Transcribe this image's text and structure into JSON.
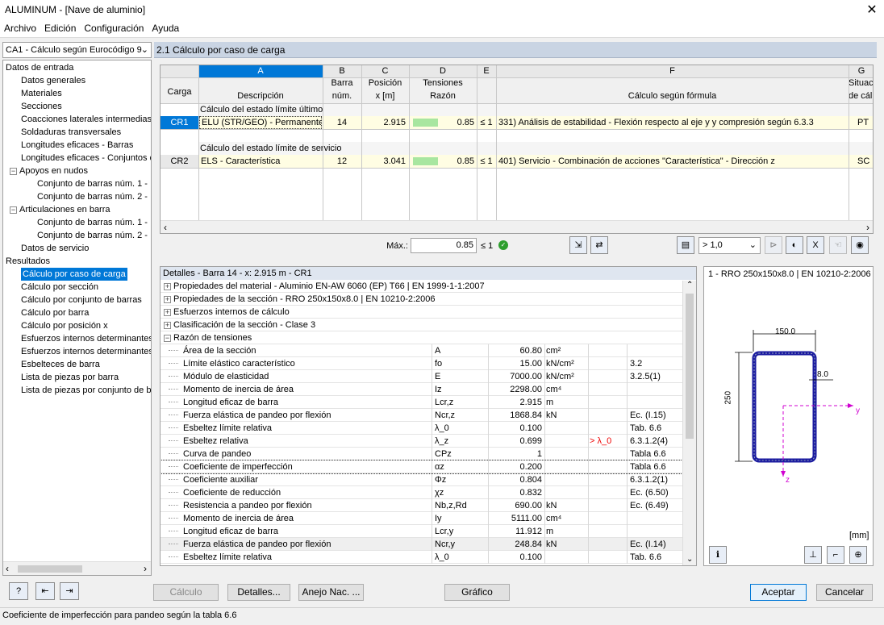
{
  "window": {
    "title": "ALUMINUM - [Nave de aluminio]"
  },
  "menu": [
    "Archivo",
    "Edición",
    "Configuración",
    "Ayuda"
  ],
  "case_selector": "CA1 - Cálculo según Eurocódigo 9",
  "tree": [
    {
      "label": "Datos de entrada",
      "level": 0
    },
    {
      "label": "Datos generales",
      "level": 1
    },
    {
      "label": "Materiales",
      "level": 1
    },
    {
      "label": "Secciones",
      "level": 1
    },
    {
      "label": "Coacciones laterales intermedias",
      "level": 1
    },
    {
      "label": "Soldaduras transversales",
      "level": 1
    },
    {
      "label": "Longitudes eficaces - Barras",
      "level": 1
    },
    {
      "label": "Longitudes eficaces - Conjuntos d",
      "level": 1
    },
    {
      "label": "Apoyos en nudos",
      "level": 1,
      "toggle": "−"
    },
    {
      "label": "Conjunto de barras núm. 1 -",
      "level": 2
    },
    {
      "label": "Conjunto de barras núm. 2 -",
      "level": 2
    },
    {
      "label": "Articulaciones en barra",
      "level": 1,
      "toggle": "−"
    },
    {
      "label": "Conjunto de barras núm. 1 -",
      "level": 2
    },
    {
      "label": "Conjunto de barras núm. 2 -",
      "level": 2
    },
    {
      "label": "Datos de servicio",
      "level": 1
    },
    {
      "label": "Resultados",
      "level": 0
    },
    {
      "label": "Cálculo por caso de carga",
      "level": 1,
      "selected": true
    },
    {
      "label": "Cálculo por sección",
      "level": 1
    },
    {
      "label": "Cálculo por conjunto de barras",
      "level": 1
    },
    {
      "label": "Cálculo por barra",
      "level": 1
    },
    {
      "label": "Cálculo por posición x",
      "level": 1
    },
    {
      "label": "Esfuerzos internos determinantes",
      "level": 1
    },
    {
      "label": "Esfuerzos internos determinantes",
      "level": 1
    },
    {
      "label": "Esbelteces de barra",
      "level": 1
    },
    {
      "label": "Lista de piezas por barra",
      "level": 1
    },
    {
      "label": "Lista de piezas por conjunto de b",
      "level": 1
    }
  ],
  "panel_title": "2.1 Cálculo por caso de carga",
  "table": {
    "col_letters": [
      "A",
      "B",
      "C",
      "D",
      "E",
      "F",
      "G"
    ],
    "header_carga": "Carga",
    "headers_top": [
      "",
      "Barra",
      "Posición",
      "Tensiones",
      "",
      "",
      "Situac"
    ],
    "headers_bottom": [
      "Descripción",
      "núm.",
      "x [m]",
      "Razón",
      "",
      "Cálculo según fórmula",
      "de cál"
    ],
    "groups": [
      {
        "title": "Cálculo del estado límite último",
        "row": {
          "id": "CR1",
          "desc": "ELU (STR/GEO) - Permanente",
          "barra": "14",
          "pos": "2.915",
          "ratio": "0.85",
          "le": "≤ 1",
          "formula": "331) Análisis de estabilidad - Flexión respecto al eje y y compresión según 6.3.3",
          "sit": "PT"
        }
      },
      {
        "title": "Cálculo del estado límite de servicio",
        "row": {
          "id": "CR2",
          "desc": "ELS - Característica",
          "barra": "12",
          "pos": "3.041",
          "ratio": "0.85",
          "le": "≤ 1",
          "formula": "401) Servicio - Combinación de acciones \"Característica\" - Dirección z",
          "sit": "SC"
        }
      }
    ],
    "ratio_fill": 0.85
  },
  "maxbar": {
    "label": "Máx.:",
    "value": "0.85",
    "le": "≤ 1",
    "filter": "> 1,0"
  },
  "details": {
    "title": "Detalles - Barra 14 - x: 2.915 m - CR1",
    "sections": [
      "Propiedades del material - Aluminio EN-AW 6060 (EP) T66 | EN 1999-1-1:2007",
      "Propiedades de la sección  -  RRO 250x150x8.0 | EN 10210-2:2006",
      "Esfuerzos internos de cálculo",
      "Clasificación de la sección - Clase 3",
      "Razón de tensiones"
    ],
    "rows": [
      {
        "name": "Área de la sección",
        "sym": "A",
        "val": "60.80",
        "unit": "cm²",
        "note": "",
        "ref": ""
      },
      {
        "name": "Límite elástico característico",
        "sym": "fo",
        "val": "15.00",
        "unit": "kN/cm²",
        "note": "",
        "ref": "3.2"
      },
      {
        "name": "Módulo de elasticidad",
        "sym": "E",
        "val": "7000.00",
        "unit": "kN/cm²",
        "note": "",
        "ref": "3.2.5(1)"
      },
      {
        "name": "Momento de inercia de área",
        "sym": "Iz",
        "val": "2298.00",
        "unit": "cm⁴",
        "note": "",
        "ref": ""
      },
      {
        "name": "Longitud eficaz de barra",
        "sym": "Lcr,z",
        "val": "2.915",
        "unit": "m",
        "note": "",
        "ref": ""
      },
      {
        "name": "Fuerza elástica de pandeo por flexión",
        "sym": "Ncr,z",
        "val": "1868.84",
        "unit": "kN",
        "note": "",
        "ref": "Ec. (I.15)"
      },
      {
        "name": "Esbeltez límite relativa",
        "sym": "λ_0",
        "val": "0.100",
        "unit": "",
        "note": "",
        "ref": "Tab. 6.6"
      },
      {
        "name": "Esbeltez relativa",
        "sym": "λ_z",
        "val": "0.699",
        "unit": "",
        "note": "> λ_0",
        "ref": "6.3.1.2(4)"
      },
      {
        "name": "Curva de pandeo",
        "sym": "CPz",
        "val": "1",
        "unit": "",
        "note": "",
        "ref": "Tabla 6.6"
      },
      {
        "name": "Coeficiente de imperfección",
        "sym": "αz",
        "val": "0.200",
        "unit": "",
        "note": "",
        "ref": "Tabla 6.6"
      },
      {
        "name": "Coeficiente auxiliar",
        "sym": "Φz",
        "val": "0.804",
        "unit": "",
        "note": "",
        "ref": "6.3.1.2(1)"
      },
      {
        "name": "Coeficiente de reducción",
        "sym": "χz",
        "val": "0.832",
        "unit": "",
        "note": "",
        "ref": "Ec. (6.50)"
      },
      {
        "name": "Resistencia a pandeo por flexión",
        "sym": "Nb,z,Rd",
        "val": "690.00",
        "unit": "kN",
        "note": "",
        "ref": "Ec. (6.49)"
      },
      {
        "name": "Momento de inercia de área",
        "sym": "Iy",
        "val": "5111.00",
        "unit": "cm⁴",
        "note": "",
        "ref": ""
      },
      {
        "name": "Longitud eficaz de barra",
        "sym": "Lcr,y",
        "val": "11.912",
        "unit": "m",
        "note": "",
        "ref": ""
      },
      {
        "name": "Fuerza elástica de pandeo por flexión",
        "sym": "Ncr,y",
        "val": "248.84",
        "unit": "kN",
        "note": "",
        "ref": "Ec. (I.14)"
      },
      {
        "name": "Esbeltez límite relativa",
        "sym": "λ_0",
        "val": "0.100",
        "unit": "",
        "note": "",
        "ref": "Tab. 6.6"
      }
    ]
  },
  "graphic": {
    "title": "1 - RRO 250x150x8.0 | EN 10210-2:2006",
    "width_label": "150.0",
    "height_label": "250.0",
    "thick_label": "8.0",
    "axis_y": "y",
    "axis_z": "z",
    "units": "[mm]"
  },
  "buttons": {
    "calc": "Cálculo",
    "details": "Detalles...",
    "annex": "Anejo Nac. ...",
    "graphic": "Gráfico",
    "ok": "Aceptar",
    "cancel": "Cancelar"
  },
  "status": "Coeficiente de imperfección para pandeo según la tabla 6.6",
  "colors": {
    "accent": "#0078d7",
    "panel_header": "#c9d4e3",
    "ratio_bar": "#a8e6a0",
    "row_highlight": "#fffde3"
  }
}
